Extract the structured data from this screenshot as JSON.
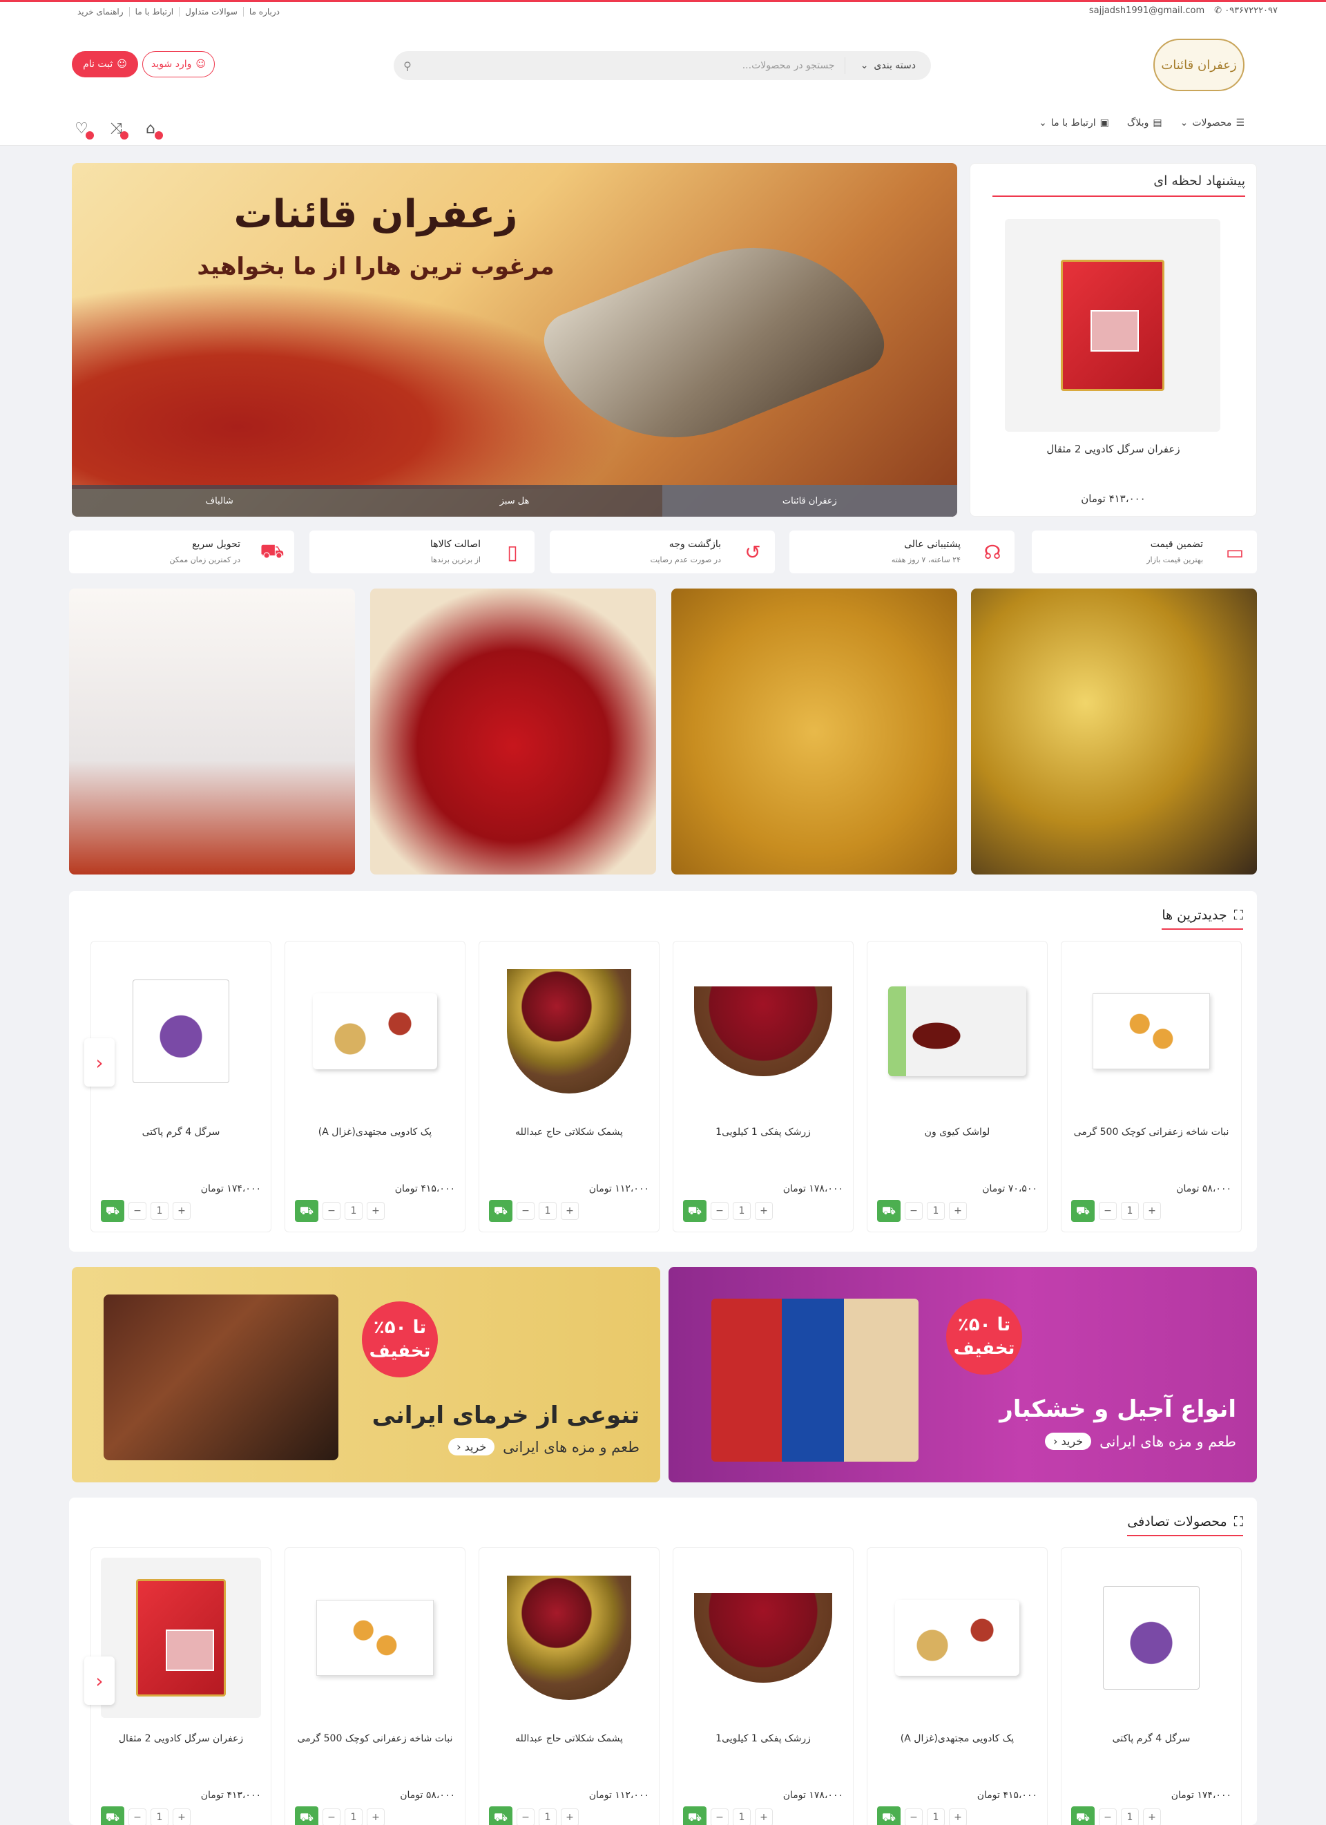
{
  "topbar": {
    "links": [
      "راهنمای خرید",
      "ارتباط با ما",
      "سوالات متداول",
      "درباره ما"
    ],
    "email": "sajjadsh1991@gmail.com",
    "phone": "۰۹۳۶۷۲۲۲۰۹۷"
  },
  "logo_text": "زعفران قائنات",
  "search": {
    "category": "دسته بندی",
    "placeholder": "جستجو در محصولات..."
  },
  "auth": {
    "login": "وارد شوید",
    "register": "ثبت نام"
  },
  "nav": {
    "items": [
      "محصولات",
      "وبلاگ",
      "ارتباط با ما"
    ]
  },
  "slider": {
    "title": "زعفران قائنات",
    "subtitle": "مرغوب ترین هارا از ما بخواهید",
    "tabs": [
      "زعفران قائنات",
      "هل سبز",
      "شالباف"
    ]
  },
  "offer": {
    "title": "پیشنهاد لحظه ای",
    "name": "زعفران سرگل کادویی 2 مثقال",
    "price": "۴۱۳،۰۰۰ تومان"
  },
  "features": [
    {
      "title": "تضمین قیمت",
      "sub": "بهترین قیمت بازار",
      "icon": "card-icon"
    },
    {
      "title": "پشتیبانی عالی",
      "sub": "۲۴ ساعته، ۷ روز هفته",
      "icon": "headset-icon"
    },
    {
      "title": "بازگشت وجه",
      "sub": "در صورت عدم رضایت",
      "icon": "history-icon"
    },
    {
      "title": "اصالت کالاها",
      "sub": "از برترین برندها",
      "icon": "document-icon"
    },
    {
      "title": "تحویل سریع",
      "sub": "در کمترین زمان ممکن",
      "icon": "truck-icon"
    }
  ],
  "newest": {
    "title": "جدیدترین ها",
    "products": [
      {
        "name": "نبات شاخه زعفرانی کوچک 500 گرمی",
        "price": "۵۸،۰۰۰ تومان",
        "qty": "1"
      },
      {
        "name": "لواشک کیوی ون",
        "price": "۷۰،۵۰۰ تومان",
        "qty": "1"
      },
      {
        "name": "زرشک پفکی 1 کیلویی1",
        "price": "۱۷۸،۰۰۰ تومان",
        "qty": "1"
      },
      {
        "name": "پشمک شکلاتی حاج عبدالله",
        "price": "۱۱۲،۰۰۰ تومان",
        "qty": "1"
      },
      {
        "name": "پک کادویی مجتهدی(غزال A)",
        "price": "۴۱۵،۰۰۰ تومان",
        "qty": "1"
      },
      {
        "name": "سرگل 4 گرم پاکتی",
        "price": "۱۷۴،۰۰۰ تومان",
        "qty": "1"
      }
    ]
  },
  "promos": {
    "dates": {
      "discount_a": "تا ۵۰٪",
      "discount_b": "تخفیف",
      "title": "تنوعی از خرمای ایرانی",
      "sub": "طعم و مزه های ایرانی",
      "buy": "خرید"
    },
    "nuts": {
      "discount_a": "تا ۵۰٪",
      "discount_b": "تخفیف",
      "title": "انواع آجیل و خشکبار",
      "sub": "طعم و مزه های ایرانی",
      "buy": "خرید"
    }
  },
  "random": {
    "title": "محصولات تصادفی",
    "products": [
      {
        "name": "سرگل 4 گرم پاکتی",
        "price": "۱۷۴،۰۰۰ تومان",
        "qty": "1"
      },
      {
        "name": "پک کادویی مجتهدی(غزال A)",
        "price": "۴۱۵،۰۰۰ تومان",
        "qty": "1"
      },
      {
        "name": "زرشک پفکی 1 کیلویی1",
        "price": "۱۷۸،۰۰۰ تومان",
        "qty": "1"
      },
      {
        "name": "پشمک شکلاتی حاج عبدالله",
        "price": "۱۱۲،۰۰۰ تومان",
        "qty": "1"
      },
      {
        "name": "نبات شاخه زعفرانی کوچک 500 گرمی",
        "price": "۵۸،۰۰۰ تومان",
        "qty": "1"
      },
      {
        "name": "زعفران سرگل کادویی 2 مثقال",
        "price": "۴۱۳،۰۰۰ تومان",
        "qty": "1"
      }
    ]
  },
  "colors": {
    "accent": "#ef394e",
    "cart": "#4caf50"
  }
}
